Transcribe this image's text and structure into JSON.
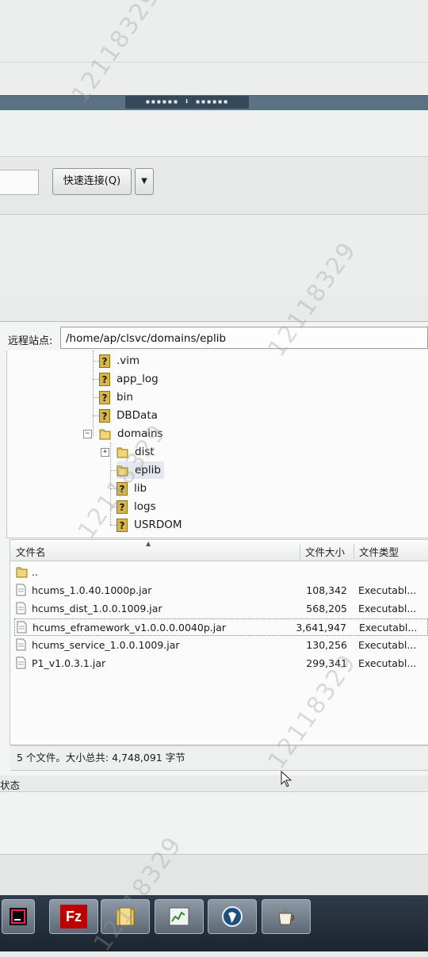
{
  "quickconnect": {
    "button_label": "快速连接(Q)",
    "dropdown_icon": "chevron-down-icon"
  },
  "splitter": {
    "grip": "▪▪▪▪▪▪ ⬇ ▪▪▪▪▪▪"
  },
  "remote": {
    "label": "远程站点:",
    "path": "/home/ap/clsvc/domains/eplib",
    "tree": [
      {
        "name": ".vim",
        "icon": "question-folder-icon"
      },
      {
        "name": "app_log",
        "icon": "question-folder-icon"
      },
      {
        "name": "bin",
        "icon": "question-folder-icon"
      },
      {
        "name": "DBData",
        "icon": "question-folder-icon"
      },
      {
        "name": "domains",
        "icon": "folder-icon",
        "expander": "−"
      },
      {
        "name": "dist",
        "icon": "folder-icon",
        "expander": "+"
      },
      {
        "name": "eplib",
        "icon": "folder-icon"
      },
      {
        "name": "lib",
        "icon": "question-folder-icon"
      },
      {
        "name": "logs",
        "icon": "question-folder-icon"
      },
      {
        "name": "USRDOM",
        "icon": "question-folder-icon"
      }
    ]
  },
  "filelist": {
    "columns": {
      "name": "文件名",
      "size": "文件大小",
      "type": "文件类型"
    },
    "parent": "..",
    "files": [
      {
        "name": "hcums_1.0.40.1000p.jar",
        "size": "108,342",
        "type": "Executabl..."
      },
      {
        "name": "hcums_dist_1.0.0.1009.jar",
        "size": "568,205",
        "type": "Executabl..."
      },
      {
        "name": "hcums_eframework_v1.0.0.0.0040p.jar",
        "size": "3,641,947",
        "type": "Executabl..."
      },
      {
        "name": "hcums_service_1.0.0.1009.jar",
        "size": "130,256",
        "type": "Executabl..."
      },
      {
        "name": "P1_v1.0.3.1.jar",
        "size": "299,341",
        "type": "Executabl..."
      }
    ],
    "summary": "5 个文件。大小总共: 4,748,091 字节"
  },
  "status": {
    "label": "状态"
  },
  "watermark": {
    "text": "12118329"
  },
  "taskbar": {
    "apps": [
      {
        "name": "intellij-icon"
      },
      {
        "name": "filezilla-icon",
        "glyph": "Fz"
      },
      {
        "name": "file-manager-icon"
      },
      {
        "name": "chart-app-icon"
      },
      {
        "name": "globe-icon"
      },
      {
        "name": "coffee-cup-icon"
      }
    ]
  }
}
